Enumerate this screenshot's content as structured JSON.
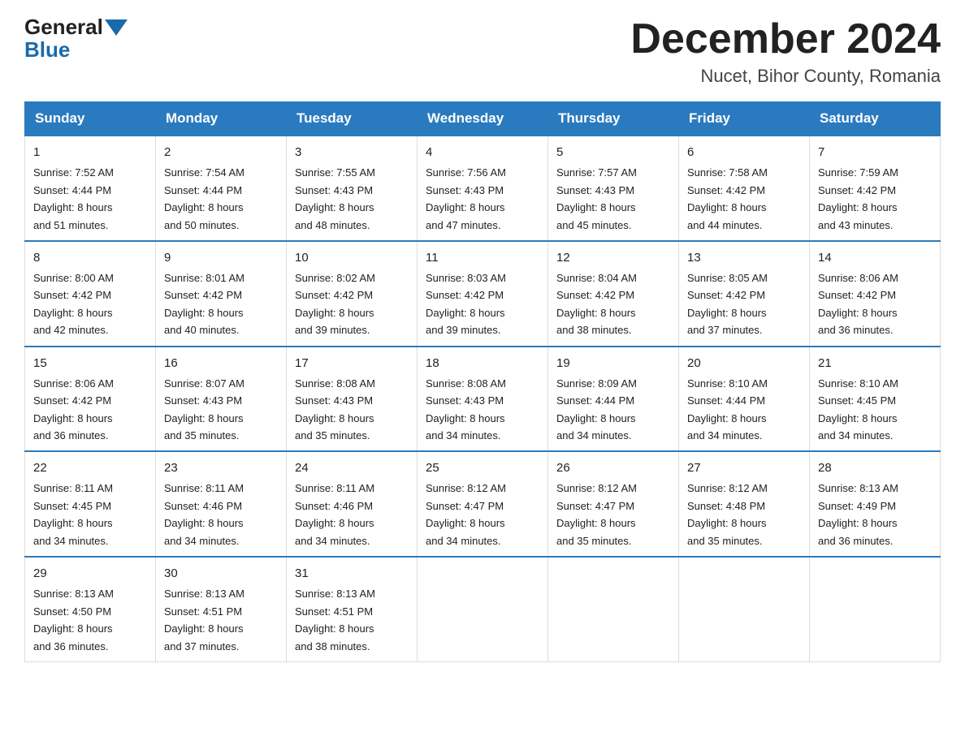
{
  "logo": {
    "general": "General",
    "blue": "Blue"
  },
  "header": {
    "title": "December 2024",
    "subtitle": "Nucet, Bihor County, Romania"
  },
  "columns": [
    "Sunday",
    "Monday",
    "Tuesday",
    "Wednesday",
    "Thursday",
    "Friday",
    "Saturday"
  ],
  "weeks": [
    [
      {
        "day": "1",
        "sunrise": "7:52 AM",
        "sunset": "4:44 PM",
        "daylight": "8 hours and 51 minutes."
      },
      {
        "day": "2",
        "sunrise": "7:54 AM",
        "sunset": "4:44 PM",
        "daylight": "8 hours and 50 minutes."
      },
      {
        "day": "3",
        "sunrise": "7:55 AM",
        "sunset": "4:43 PM",
        "daylight": "8 hours and 48 minutes."
      },
      {
        "day": "4",
        "sunrise": "7:56 AM",
        "sunset": "4:43 PM",
        "daylight": "8 hours and 47 minutes."
      },
      {
        "day": "5",
        "sunrise": "7:57 AM",
        "sunset": "4:43 PM",
        "daylight": "8 hours and 45 minutes."
      },
      {
        "day": "6",
        "sunrise": "7:58 AM",
        "sunset": "4:42 PM",
        "daylight": "8 hours and 44 minutes."
      },
      {
        "day": "7",
        "sunrise": "7:59 AM",
        "sunset": "4:42 PM",
        "daylight": "8 hours and 43 minutes."
      }
    ],
    [
      {
        "day": "8",
        "sunrise": "8:00 AM",
        "sunset": "4:42 PM",
        "daylight": "8 hours and 42 minutes."
      },
      {
        "day": "9",
        "sunrise": "8:01 AM",
        "sunset": "4:42 PM",
        "daylight": "8 hours and 40 minutes."
      },
      {
        "day": "10",
        "sunrise": "8:02 AM",
        "sunset": "4:42 PM",
        "daylight": "8 hours and 39 minutes."
      },
      {
        "day": "11",
        "sunrise": "8:03 AM",
        "sunset": "4:42 PM",
        "daylight": "8 hours and 39 minutes."
      },
      {
        "day": "12",
        "sunrise": "8:04 AM",
        "sunset": "4:42 PM",
        "daylight": "8 hours and 38 minutes."
      },
      {
        "day": "13",
        "sunrise": "8:05 AM",
        "sunset": "4:42 PM",
        "daylight": "8 hours and 37 minutes."
      },
      {
        "day": "14",
        "sunrise": "8:06 AM",
        "sunset": "4:42 PM",
        "daylight": "8 hours and 36 minutes."
      }
    ],
    [
      {
        "day": "15",
        "sunrise": "8:06 AM",
        "sunset": "4:42 PM",
        "daylight": "8 hours and 36 minutes."
      },
      {
        "day": "16",
        "sunrise": "8:07 AM",
        "sunset": "4:43 PM",
        "daylight": "8 hours and 35 minutes."
      },
      {
        "day": "17",
        "sunrise": "8:08 AM",
        "sunset": "4:43 PM",
        "daylight": "8 hours and 35 minutes."
      },
      {
        "day": "18",
        "sunrise": "8:08 AM",
        "sunset": "4:43 PM",
        "daylight": "8 hours and 34 minutes."
      },
      {
        "day": "19",
        "sunrise": "8:09 AM",
        "sunset": "4:44 PM",
        "daylight": "8 hours and 34 minutes."
      },
      {
        "day": "20",
        "sunrise": "8:10 AM",
        "sunset": "4:44 PM",
        "daylight": "8 hours and 34 minutes."
      },
      {
        "day": "21",
        "sunrise": "8:10 AM",
        "sunset": "4:45 PM",
        "daylight": "8 hours and 34 minutes."
      }
    ],
    [
      {
        "day": "22",
        "sunrise": "8:11 AM",
        "sunset": "4:45 PM",
        "daylight": "8 hours and 34 minutes."
      },
      {
        "day": "23",
        "sunrise": "8:11 AM",
        "sunset": "4:46 PM",
        "daylight": "8 hours and 34 minutes."
      },
      {
        "day": "24",
        "sunrise": "8:11 AM",
        "sunset": "4:46 PM",
        "daylight": "8 hours and 34 minutes."
      },
      {
        "day": "25",
        "sunrise": "8:12 AM",
        "sunset": "4:47 PM",
        "daylight": "8 hours and 34 minutes."
      },
      {
        "day": "26",
        "sunrise": "8:12 AM",
        "sunset": "4:47 PM",
        "daylight": "8 hours and 35 minutes."
      },
      {
        "day": "27",
        "sunrise": "8:12 AM",
        "sunset": "4:48 PM",
        "daylight": "8 hours and 35 minutes."
      },
      {
        "day": "28",
        "sunrise": "8:13 AM",
        "sunset": "4:49 PM",
        "daylight": "8 hours and 36 minutes."
      }
    ],
    [
      {
        "day": "29",
        "sunrise": "8:13 AM",
        "sunset": "4:50 PM",
        "daylight": "8 hours and 36 minutes."
      },
      {
        "day": "30",
        "sunrise": "8:13 AM",
        "sunset": "4:51 PM",
        "daylight": "8 hours and 37 minutes."
      },
      {
        "day": "31",
        "sunrise": "8:13 AM",
        "sunset": "4:51 PM",
        "daylight": "8 hours and 38 minutes."
      },
      null,
      null,
      null,
      null
    ]
  ],
  "labels": {
    "sunrise": "Sunrise:",
    "sunset": "Sunset:",
    "daylight": "Daylight:"
  }
}
